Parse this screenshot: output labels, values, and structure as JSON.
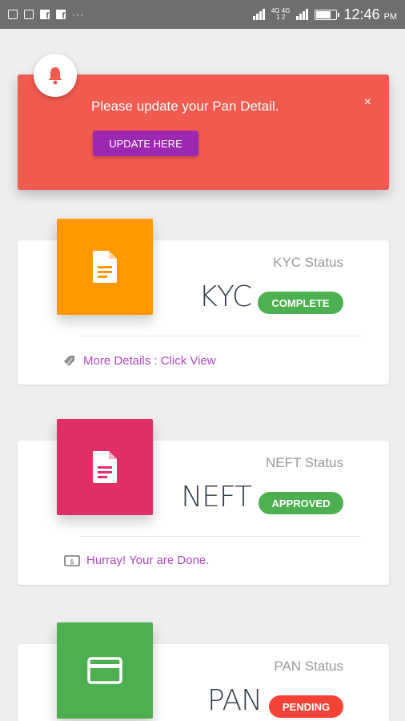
{
  "status_bar": {
    "network_top": "4G 4G",
    "network_bottom": "1 2",
    "time": "12:46",
    "ampm": "PM"
  },
  "alert": {
    "message": "Please update your Pan Detail.",
    "button_label": "UPDATE HERE",
    "close": "×",
    "icon": "bell-icon",
    "background": "#f15a4f"
  },
  "cards": {
    "kyc": {
      "label": "KYC Status",
      "title": "KYC",
      "status": "COMPLETE",
      "status_color": "#4caf50",
      "tile_color": "#ff9800",
      "icon": "document-icon",
      "footer": "More Details : Click View",
      "footer_icon": "tag-icon"
    },
    "neft": {
      "label": "NEFT Status",
      "title": "NEFT",
      "status": "APPROVED",
      "status_color": "#4caf50",
      "tile_color": "#e91e63",
      "icon": "document-icon",
      "footer": "Hurray! Your are Done.",
      "footer_icon": "money-icon"
    },
    "pan": {
      "label": "PAN Status",
      "title": "PAN",
      "status": "PENDING",
      "status_color": "#f44336",
      "tile_color": "#4caf50",
      "icon": "card-icon"
    }
  }
}
